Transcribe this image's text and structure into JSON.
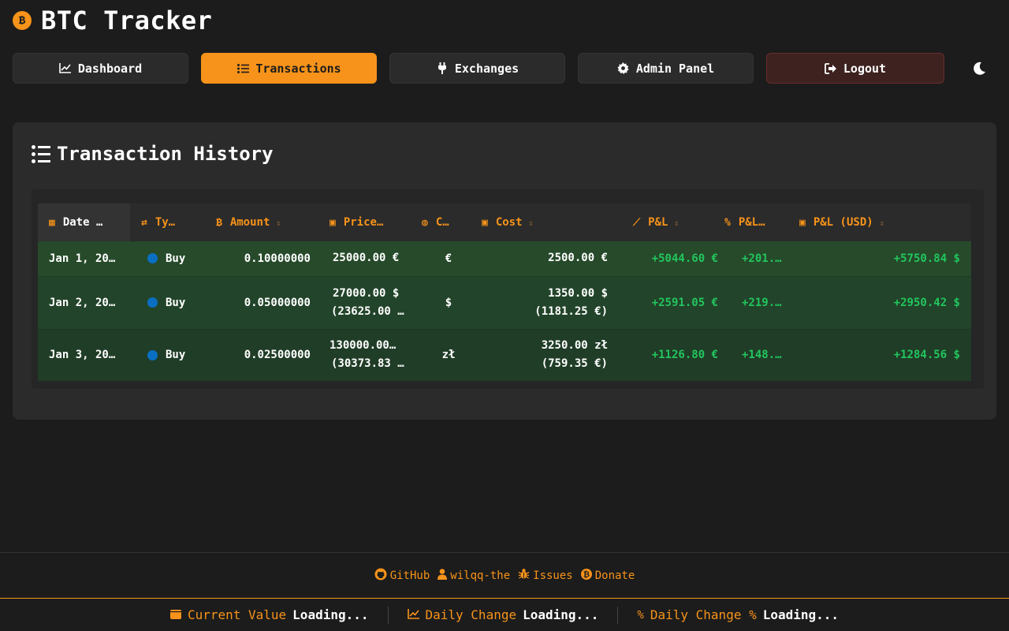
{
  "header": {
    "title": "BTC Tracker",
    "logo_glyph": "₿"
  },
  "nav": {
    "dashboard": "Dashboard",
    "transactions": "Transactions",
    "exchanges": "Exchanges",
    "admin": "Admin Panel",
    "logout": "Logout"
  },
  "card": {
    "title": "Transaction History"
  },
  "table": {
    "headers": {
      "date": "Date …",
      "type": "Ty…",
      "amount": "Amount",
      "price": "Price…",
      "currency": "C…",
      "cost": "Cost",
      "pnl": "P&L",
      "pnl_pct": "P&L…",
      "pnl_usd": "P&L (USD)"
    },
    "rows": [
      {
        "date": "Jan 1, 20…",
        "type": "Buy",
        "amount": "0.10000000",
        "price": "25000.00 €",
        "price_sub": "",
        "currency": "€",
        "cost": "2500.00 €",
        "cost_sub": "",
        "pnl": "+5044.60 €",
        "pnl_pct": "+201.7…",
        "pnl_usd": "+5750.84 $"
      },
      {
        "date": "Jan 2, 20…",
        "type": "Buy",
        "amount": "0.05000000",
        "price": "27000.00 $",
        "price_sub": "(23625.00 €)",
        "currency": "$",
        "cost": "1350.00 $",
        "cost_sub": "(1181.25 €)",
        "pnl": "+2591.05 €",
        "pnl_pct": "+219.3…",
        "pnl_usd": "+2950.42 $"
      },
      {
        "date": "Jan 3, 20…",
        "type": "Buy",
        "amount": "0.02500000",
        "price": "130000.00…",
        "price_sub": "(30373.83 €)",
        "currency": "zł",
        "cost": "3250.00 zł",
        "cost_sub": "(759.35 €)",
        "pnl": "+1126.80 €",
        "pnl_pct": "+148.3…",
        "pnl_usd": "+1284.56 $"
      }
    ]
  },
  "footer": {
    "github": "GitHub",
    "user": "wilqq-the",
    "issues": "Issues",
    "donate": "Donate"
  },
  "status": {
    "current_value_label": "Current Value",
    "current_value": "Loading...",
    "daily_change_label": "Daily Change",
    "daily_change": "Loading...",
    "daily_change_pct_label": "Daily Change %",
    "daily_change_pct": "Loading..."
  },
  "colors": {
    "accent": "#f7931a",
    "background": "#1c1c1c",
    "card": "#2b2b2b",
    "positive": "#22c55e",
    "buy": "#0a6fc2",
    "logout": "#3d2220"
  }
}
